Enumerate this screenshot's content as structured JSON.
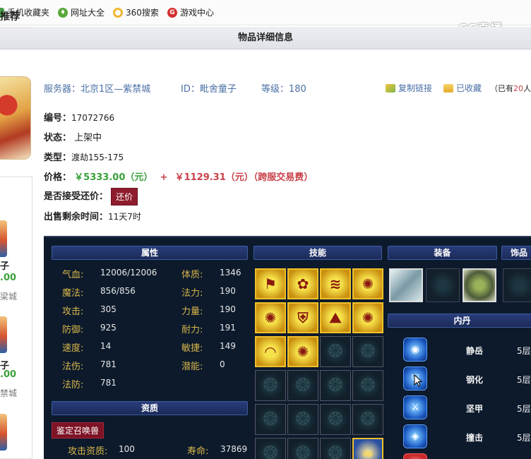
{
  "bookmarks": [
    {
      "label": "手机收藏夹",
      "icon": "phone-icon"
    },
    {
      "label": "网址大全",
      "icon": "web-directory-icon"
    },
    {
      "label": "360搜索",
      "icon": "360-search-icon"
    },
    {
      "label": "游戏中心",
      "icon": "game-center-icon"
    }
  ],
  "watermark": "CC直播",
  "page_title": "物品详细信息",
  "header": {
    "server_label": "服务器：",
    "server_value": "北京1区—紫禁城",
    "id_label": "ID：",
    "id_value": "毗舍童子",
    "level_label": "等级：",
    "level_value": "180",
    "copy_link": "复制链接",
    "favorited": "已收藏",
    "fav_prefix": "（已有",
    "fav_count": "20",
    "fav_suffix": "人"
  },
  "details": {
    "number_label": "编号：",
    "number_value": "17072766",
    "status_label": "状态：",
    "status_value": "上架中",
    "type_label": "类型：",
    "type_value": "渡劫155-175",
    "price_label": "价格：",
    "price_main": "￥5333.00（元）",
    "price_plus": "+",
    "price_fee": "￥1129.31（元）（跨服交易费）",
    "bargain_label": "是否接受还价：",
    "bargain_button": "还价",
    "remaining_label": "出售剩余时间：",
    "remaining_value": "11天7时"
  },
  "recommend": {
    "title": "推荐",
    "items": [
      {
        "name": "子",
        "price": ".00",
        "server": "梁城"
      },
      {
        "name": "子",
        "price": ".00",
        "server": "禁城"
      },
      {
        "name": "子",
        "price": "",
        "server": ""
      }
    ]
  },
  "panel": {
    "attr_header": "属性",
    "skill_header": "技能",
    "equip_header": "装备",
    "acc_header": "饰品",
    "neidan_header": "内丹",
    "apt_header": "资质",
    "summon_button": "鉴定召唤兽",
    "stats_left": [
      {
        "label": "气血:",
        "value": "12006/12006"
      },
      {
        "label": "魔法:",
        "value": "856/856"
      },
      {
        "label": "攻击:",
        "value": "305"
      },
      {
        "label": "防御:",
        "value": "925"
      },
      {
        "label": "速度:",
        "value": "14"
      },
      {
        "label": "法伤:",
        "value": "781"
      },
      {
        "label": "法防:",
        "value": "781"
      }
    ],
    "stats_right": [
      {
        "label": "体质:",
        "value": "1346"
      },
      {
        "label": "法力:",
        "value": "190"
      },
      {
        "label": "力量:",
        "value": "190"
      },
      {
        "label": "耐力:",
        "value": "191"
      },
      {
        "label": "敏捷:",
        "value": "149"
      },
      {
        "label": "潜能:",
        "value": "0"
      }
    ],
    "aptitude": [
      {
        "label": "攻击资质:",
        "value": "100"
      },
      {
        "label": "寿命:",
        "value": "37869"
      }
    ],
    "neidan": [
      {
        "name": "静岳",
        "level": "5层"
      },
      {
        "name": "钢化",
        "level": "5层"
      },
      {
        "name": "坚甲",
        "level": "5层"
      },
      {
        "name": "撞击",
        "level": "5层"
      }
    ]
  },
  "colors": {
    "accent_blue": "#4a6fa5",
    "price_green": "#3aa13a",
    "price_red": "#c9414a",
    "button_red": "#8e1c2c"
  }
}
